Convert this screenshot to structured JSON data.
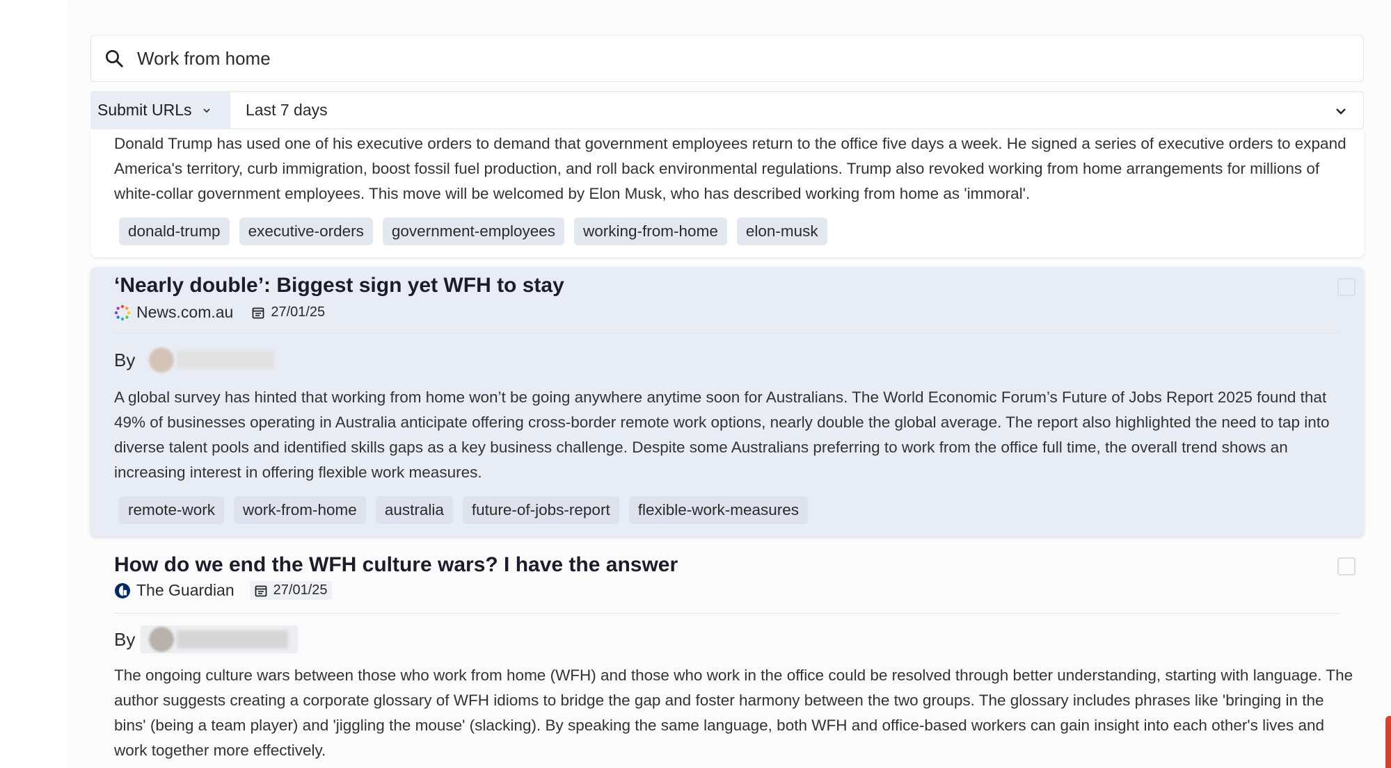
{
  "search": {
    "value": "Work from home",
    "icon": "search-icon"
  },
  "filters": {
    "submit_label": "Submit URLs",
    "range_value": "Last 7 days"
  },
  "articles": [
    {
      "summary": "Donald Trump has used one of his executive orders to demand that government employees return to the office five days a week. He signed a series of executive orders to expand America's territory, curb immigration, boost fossil fuel production, and roll back environmental regulations. Trump also revoked working from home arrangements for millions of white-collar government employees. This move will be welcomed by Elon Musk, who has described working from home as 'immoral'.",
      "tags": [
        "donald-trump",
        "executive-orders",
        "government-employees",
        "working-from-home",
        "elon-musk"
      ]
    },
    {
      "title": "‘Nearly double’: Biggest sign yet WFH to stay",
      "source": "News.com.au",
      "date": "27/01/25",
      "by_label": "By",
      "summary": "A global survey has hinted that working from home won’t be going anywhere anytime soon for Australians. The World Economic Forum’s Future of Jobs Report 2025 found that 49% of businesses operating in Australia anticipate offering cross-border remote work options, nearly double the global average. The report also highlighted the need to tap into diverse talent pools and identified skills gaps as a key business challenge. Despite some Australians preferring to work from the office full time, the overall trend shows an increasing interest in offering flexible work measures.",
      "tags": [
        "remote-work",
        "work-from-home",
        "australia",
        "future-of-jobs-report",
        "flexible-work-measures"
      ]
    },
    {
      "title": "How do we end the WFH culture wars? I have the answer",
      "source": "The Guardian",
      "date": "27/01/25",
      "by_label": "By",
      "summary": "The ongoing culture wars between those who work from home (WFH) and those who work in the office could be resolved through better understanding, starting with language. The author suggests creating a corporate glossary of WFH idioms to bridge the gap and foster harmony between the two groups. The glossary includes phrases like 'bringing in the bins' (being a team player) and 'jiggling the mouse' (slacking). By speaking the same language, both WFH and office-based workers can gain insight into each other's lives and work together more effectively."
    }
  ],
  "colors": {
    "selected_card_bg": "#e8ecf4",
    "tag_bg": "#e3e7f0",
    "guardian_blue": "#052962",
    "accent_edge": "#d9412e"
  }
}
